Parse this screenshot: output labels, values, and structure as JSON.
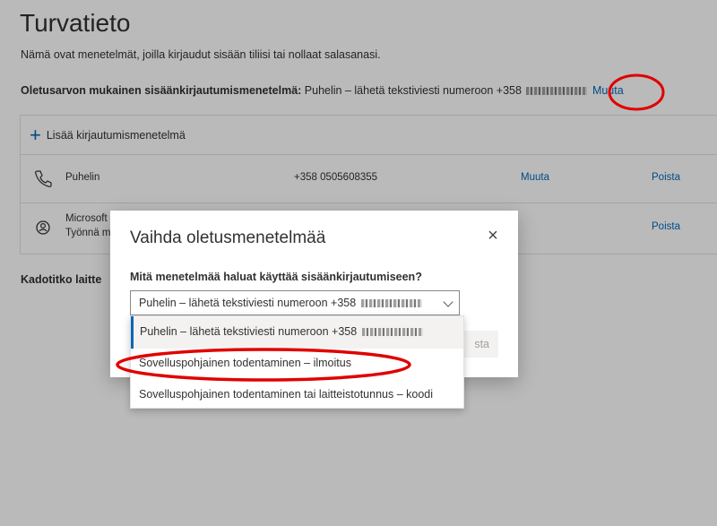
{
  "page": {
    "title": "Turvatieto",
    "description": "Nämä ovat menetelmät, joilla kirjaudut sisään tiliisi tai nollaat salasanasi.",
    "default_method_label": "Oletusarvon mukainen sisäänkirjautumismenetelmä:",
    "default_method_value": "Puhelin – lähetä tekstiviesti numeroon +358",
    "default_method_change": "Muuta",
    "add_method": "Lisää kirjautumismenetelmä",
    "methods": [
      {
        "icon": "phone-icon",
        "name": "Puhelin",
        "value": "+358 0505608355",
        "change": "Muuta",
        "delete": "Poista"
      },
      {
        "icon": "authenticator-icon",
        "name": "Microsoft",
        "subtitle": "Työnnä m",
        "delete": "Poista"
      }
    ],
    "lost_device": "Kadotitko laitte"
  },
  "dialog": {
    "title": "Vaihda oletusmenetelmää",
    "close_icon": "close-icon",
    "question": "Mitä menetelmää haluat käyttää sisäänkirjautumiseen?",
    "selected_value": "Puhelin – lähetä tekstiviesti numeroon +358",
    "confirm_partial": "sta",
    "options": [
      "Puhelin – lähetä tekstiviesti numeroon +358",
      "Sovelluspohjainen todentaminen – ilmoitus",
      "Sovelluspohjainen todentaminen tai laitteistotunnus – koodi"
    ]
  },
  "colors": {
    "accent": "#0067b8",
    "annotation": "#e00000"
  }
}
